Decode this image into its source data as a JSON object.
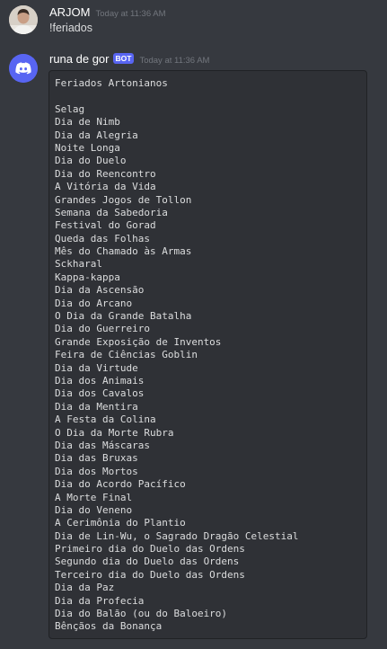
{
  "messages": [
    {
      "username": "ARJOM",
      "timestamp": "Today at 11:36 AM",
      "content": "!feriados"
    },
    {
      "username": "runa de gor",
      "bot_tag": "BOT",
      "timestamp": "Today at 11:36 AM",
      "code_lines": [
        "Feriados Artonianos",
        "",
        "Selag",
        "Dia de Nimb",
        "Dia da Alegria",
        "Noite Longa",
        "Dia do Duelo",
        "Dia do Reencontro",
        "A Vitória da Vida",
        "Grandes Jogos de Tollon",
        "Semana da Sabedoria",
        "Festival do Gorad",
        "Queda das Folhas",
        "Mês do Chamado às Armas",
        "Sckharal",
        "Kappa-kappa",
        "Dia da Ascensão",
        "Dia do Arcano",
        "O Dia da Grande Batalha",
        "Dia do Guerreiro",
        "Grande Exposição de Inventos",
        "Feira de Ciências Goblin",
        "Dia da Virtude",
        "Dia dos Animais",
        "Dia dos Cavalos",
        "Dia da Mentira",
        "A Festa da Colina",
        "O Dia da Morte Rubra",
        "Dia das Máscaras",
        "Dia das Bruxas",
        "Dia dos Mortos",
        "Dia do Acordo Pacífico",
        "A Morte Final",
        "Dia do Veneno",
        "A Cerimônia do Plantio",
        "Dia de Lin-Wu, o Sagrado Dragão Celestial",
        "Primeiro dia do Duelo das Ordens",
        "Segundo dia do Duelo das Ordens",
        "Terceiro dia do Duelo das Ordens",
        "Dia da Paz",
        "Dia da Profecia",
        "Dia do Balão (ou do Baloeiro)",
        "Bênçãos da Bonança"
      ]
    }
  ],
  "colors": {
    "background": "#36393f",
    "codeblock_bg": "#2f3136",
    "blurple": "#5865f2",
    "text": "#dcddde",
    "timestamp": "#72767d"
  },
  "icons": {
    "user_avatar": "user-avatar-icon",
    "bot_avatar": "discord-logo-icon"
  }
}
